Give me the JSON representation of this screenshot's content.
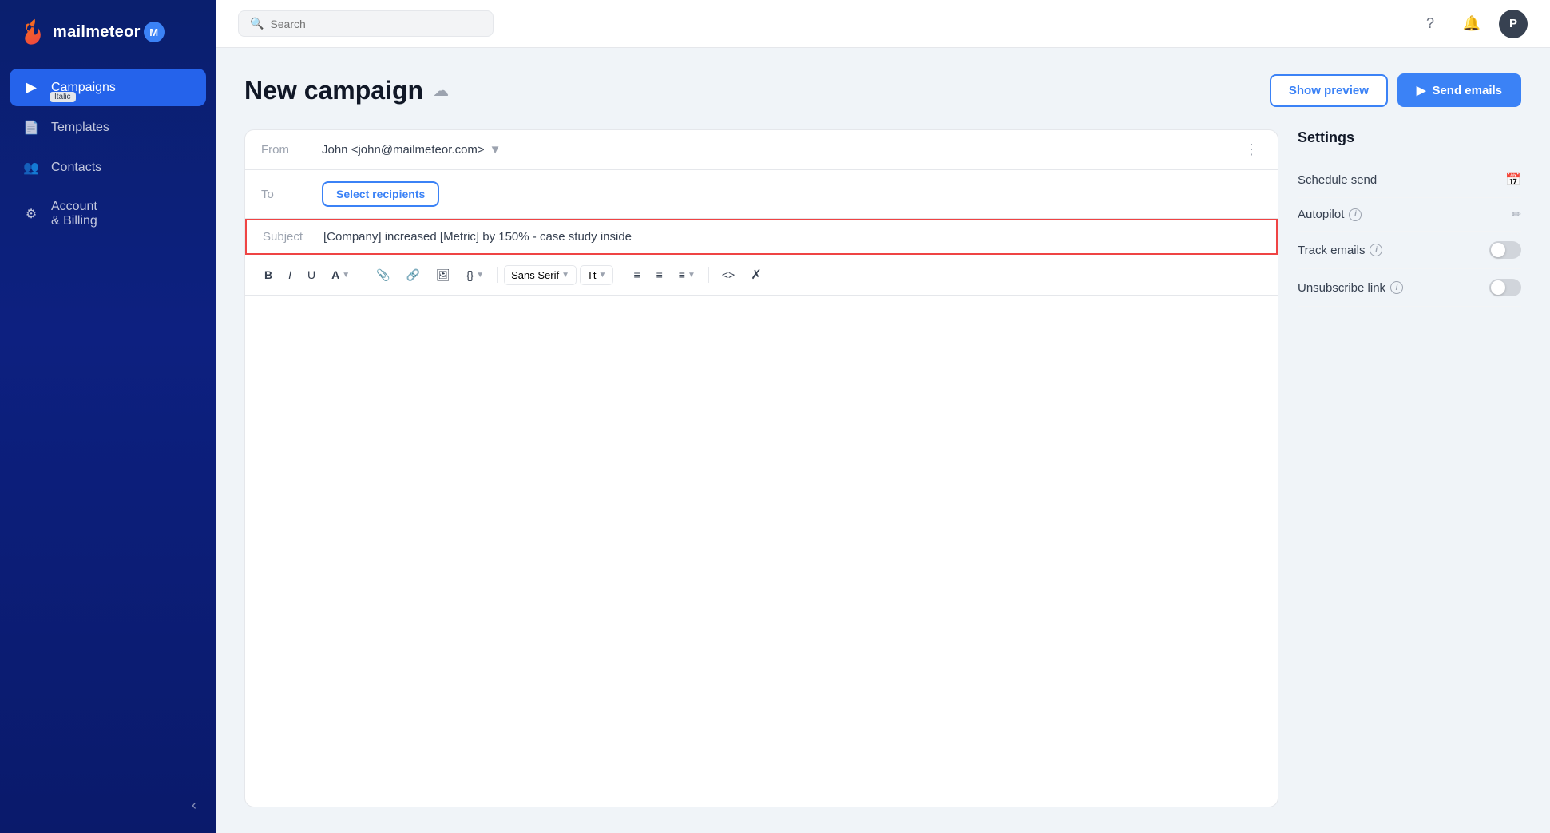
{
  "sidebar": {
    "logo": "mailmeteor",
    "nav_items": [
      {
        "id": "campaigns",
        "label": "Campaigns",
        "icon": "▶",
        "active": true,
        "badge": "Italic"
      },
      {
        "id": "templates",
        "label": "Templates",
        "icon": "📄",
        "active": false
      },
      {
        "id": "contacts",
        "label": "Contacts",
        "icon": "👥",
        "active": false
      },
      {
        "id": "account-billing",
        "label": "Account & Billing",
        "icon": "⚙",
        "active": false
      }
    ],
    "collapse_icon": "‹"
  },
  "topbar": {
    "search_placeholder": "Search",
    "help_icon": "?",
    "bell_icon": "🔔",
    "avatar_label": "P"
  },
  "page": {
    "title": "New campaign",
    "cloud_icon": "☁",
    "actions": {
      "show_preview": "Show preview",
      "send_emails": "Send emails"
    }
  },
  "composer": {
    "from_label": "From",
    "from_value": "John <john@mailmeteor.com>",
    "to_label": "To",
    "select_recipients_label": "Select recipients",
    "subject_label": "Subject",
    "subject_value": "[Company] increased [Metric] by 150% - case study inside"
  },
  "toolbar": {
    "bold": "B",
    "italic": "I",
    "underline": "U",
    "color": "A",
    "attach": "📎",
    "link": "🔗",
    "image": "🖼",
    "code": "{}",
    "font": "Sans Serif",
    "font_size": "Tt",
    "bullet_ordered": "≡",
    "bullet_unordered": "≡",
    "align": "≡",
    "html": "<>",
    "clear": "✗"
  },
  "settings": {
    "title": "Settings",
    "items": [
      {
        "id": "schedule-send",
        "label": "Schedule send",
        "type": "icon",
        "icon": "calendar"
      },
      {
        "id": "autopilot",
        "label": "Autopilot",
        "type": "icon",
        "icon": "pencil",
        "has_info": true
      },
      {
        "id": "track-emails",
        "label": "Track emails",
        "type": "toggle",
        "value": false,
        "has_info": true
      },
      {
        "id": "unsubscribe-link",
        "label": "Unsubscribe link",
        "type": "toggle",
        "value": false,
        "has_info": true
      }
    ]
  },
  "colors": {
    "brand_blue": "#2563eb",
    "sidebar_bg": "#0a1f6e",
    "active_nav": "#2563eb",
    "subject_border": "#ef4444"
  }
}
